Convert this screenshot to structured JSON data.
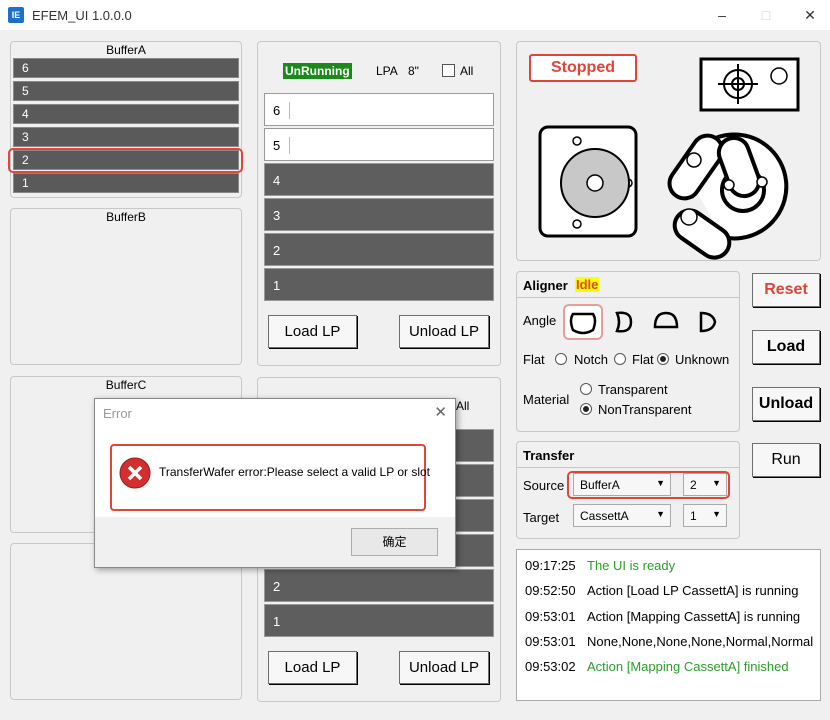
{
  "window": {
    "title": "EFEM_UI 1.0.0.0",
    "icon_text": "IE"
  },
  "bufferA": {
    "title": "BufferA",
    "slots": [
      "6",
      "5",
      "4",
      "3",
      "2",
      "1"
    ]
  },
  "bufferB": {
    "title": "BufferB"
  },
  "bufferC": {
    "title": "BufferC"
  },
  "lpa": {
    "status": "UnRunning",
    "port_label": "LPA",
    "size": "8\"",
    "all_label": "All",
    "slots": [
      "6",
      "5",
      "4",
      "3",
      "2",
      "1"
    ],
    "load_label": "Load LP",
    "unload_label": "Unload LP"
  },
  "lpb": {
    "all_label": "All",
    "slots": [
      "2",
      "1"
    ],
    "load_label": "Load LP",
    "unload_label": "Unload LP"
  },
  "robot": {
    "status": "Stopped"
  },
  "aligner": {
    "title": "Aligner",
    "status": "Idle",
    "angle_label": "Angle",
    "flat_label": "Flat",
    "flat_options": [
      {
        "label": "Notch",
        "selected": false
      },
      {
        "label": "Flat",
        "selected": false
      },
      {
        "label": "Unknown",
        "selected": true
      }
    ],
    "material_label": "Material",
    "material_options": [
      {
        "label": "Transparent",
        "selected": false
      },
      {
        "label": "NonTransparent",
        "selected": true
      }
    ]
  },
  "actions": {
    "reset": "Reset",
    "load": "Load",
    "unload": "Unload",
    "run": "Run"
  },
  "transfer": {
    "title": "Transfer",
    "source_label": "Source",
    "source_location": "BufferA",
    "source_slot": "2",
    "target_label": "Target",
    "target_location": "CassettA",
    "target_slot": "1"
  },
  "log": [
    {
      "time": "09:17:25",
      "message": "The UI is ready",
      "color": "#2a9d2a"
    },
    {
      "time": "09:52:50",
      "message": "Action [Load LP CassettA] is running",
      "color": "#000000"
    },
    {
      "time": "09:53:01",
      "message": "Action [Mapping CassettA] is running",
      "color": "#000000"
    },
    {
      "time": "09:53:01",
      "message": "None,None,None,None,Normal,Normal",
      "color": "#000000"
    },
    {
      "time": "09:53:02",
      "message": "Action [Mapping CassettA] finished",
      "color": "#2a9d2a"
    }
  ],
  "dialog": {
    "title": "Error",
    "message": "TransferWafer error:Please select a valid LP or slot",
    "ok_label": "确定"
  },
  "colors": {
    "accent_red": "#e0453a",
    "running_green": "#1a8a1a",
    "idle_yellow": "#ffff00"
  }
}
